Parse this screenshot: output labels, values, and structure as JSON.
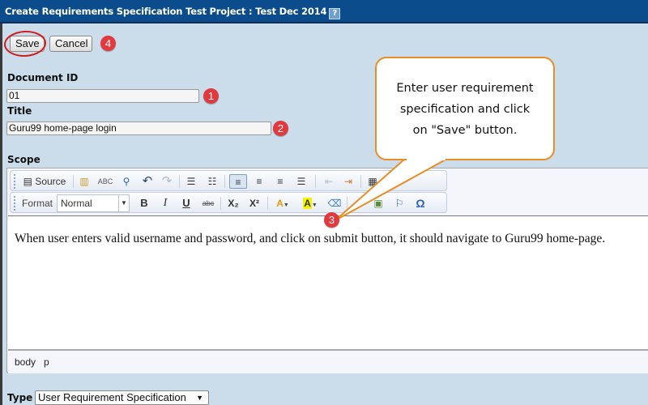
{
  "window": {
    "title": "Create Requirements Specification Test Project : Test Dec 2014",
    "help_icon": "?"
  },
  "actions": {
    "save_label": "Save",
    "cancel_label": "Cancel"
  },
  "form": {
    "document_id": {
      "label": "Document ID",
      "value": "01"
    },
    "title": {
      "label": "Title",
      "value": "Guru99 home-page login"
    },
    "scope": {
      "label": "Scope"
    },
    "type": {
      "label": "Type",
      "selected": "User Requirement Specification"
    }
  },
  "editor": {
    "toolbar_row1": {
      "source_label": "Source",
      "icons": [
        "source-icon",
        "paste-icon",
        "spellcheck-icon",
        "find-icon",
        "undo-icon",
        "redo-icon",
        "numbered-list-icon",
        "bulleted-list-icon",
        "align-left-icon",
        "align-center-icon",
        "align-right-icon",
        "justify-icon",
        "outdent-icon",
        "indent-icon",
        "table-icon"
      ]
    },
    "toolbar_row2": {
      "format_label": "Format",
      "format_value": "Normal",
      "bold": "B",
      "italic": "I",
      "underline": "U",
      "strike": "abc",
      "subscript": "X₂",
      "superscript": "X²",
      "text_color": "A",
      "bg_color": "A",
      "special_char": "Ω"
    },
    "content": "When user enters valid username and password, and click on submit button, it should navigate to Guru99 home-page.",
    "path": [
      "body",
      "p"
    ]
  },
  "annotations": {
    "badges": [
      "1",
      "2",
      "3",
      "4"
    ],
    "callout_lines": [
      "Enter user requirement",
      "specification and click",
      "on \"Save\" button."
    ],
    "colors": {
      "badge": "#e03a3e",
      "callout_border": "#e98d26",
      "ring": "#d01c1c"
    }
  },
  "theme": {
    "titlebar": "#0a4c8c",
    "background": "#cbdcea"
  }
}
